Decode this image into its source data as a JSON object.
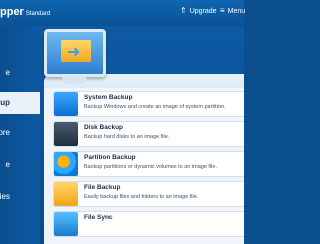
{
  "titlebar": {
    "app_title": "pper",
    "edition": "Standard",
    "upgrade": "Upgrade",
    "menu": "Menu",
    "upgrade_icon": "upgrade-arrow-icon",
    "menu_icon": "menu-lines-icon"
  },
  "sidebar": {
    "items": [
      {
        "label": "e",
        "active": false
      },
      {
        "label": "up",
        "active": true
      },
      {
        "label": "ore",
        "active": false
      },
      {
        "label": "e",
        "active": false
      },
      {
        "label": "ies",
        "active": false
      }
    ]
  },
  "backup": {
    "items": [
      {
        "title": "System Backup",
        "desc": "Backup Windows and create an image of system partition.",
        "icon": "system-backup-icon"
      },
      {
        "title": "Disk Backup",
        "desc": "Backup hard disks to an image file.",
        "icon": "disk-backup-icon"
      },
      {
        "title": "Partition Backup",
        "desc": "Backup partitions or dynamic volumes to an image file.",
        "icon": "partition-backup-icon"
      },
      {
        "title": "File Backup",
        "desc": "Easily backup files and folders to an image file.",
        "icon": "file-backup-icon"
      },
      {
        "title": "File Sync",
        "desc": "",
        "icon": "file-sync-icon"
      }
    ]
  },
  "colors": {
    "primary_blue": "#0b4f8f",
    "panel_light": "#eef4fa"
  }
}
